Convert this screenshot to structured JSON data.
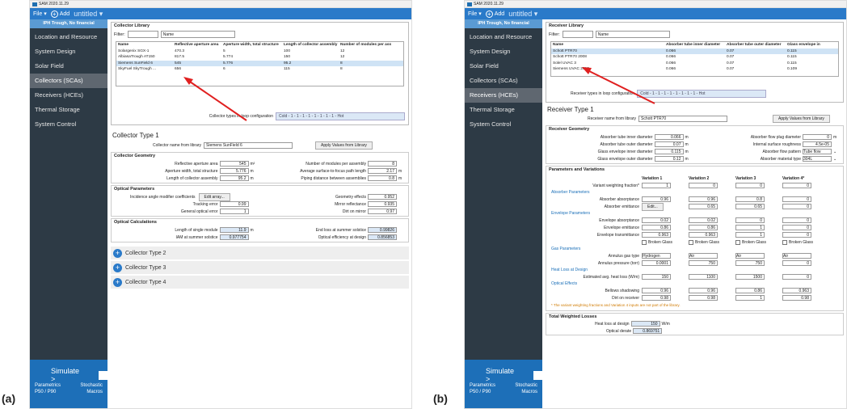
{
  "labels": {
    "a": "(a)",
    "b": "(b)"
  },
  "app": {
    "title": "SAM 2020.11.29",
    "file": "File ▾",
    "add": "Add",
    "filename": "untitled ▾"
  },
  "sidebar": {
    "caption": "IPH Trough, No financial",
    "items": [
      "Location and Resource",
      "System Design",
      "Solar Field",
      "Collectors (SCAs)",
      "Receivers (HCEs)",
      "Thermal Storage",
      "System Control"
    ],
    "simulate": "Simulate >",
    "bottom": [
      "Parametrics",
      "Stochastic",
      "P50 / P90",
      "Macros"
    ]
  },
  "pa": {
    "lib_title": "Collector Library",
    "filter": "Filter:",
    "filter_sel": "Name",
    "headers": [
      "Name",
      "Reflective aperture area",
      "Aperture width, total structure",
      "Length of collector assembly",
      "Number of modules per ass"
    ],
    "rows": [
      [
        "Solargenix SGX-1",
        "470.3",
        "5",
        "100",
        "12"
      ],
      [
        "AlbiasaTrough AT150",
        "817.5",
        "5.774",
        "150",
        "12"
      ],
      [
        "Siemens SunField 6",
        "545",
        "5.776",
        "95.2",
        "8"
      ],
      [
        "SkyFuel SkyTrough ...",
        "656",
        "6",
        "115",
        "8"
      ]
    ],
    "cfg_label": "Collector types in loop configuration",
    "cfg_value": "Cold - 1 - 1 - 1 - 1 - 1 - 1 - 1 - 1 - Hot",
    "type_title": "Collector Type 1",
    "name_label": "Collector name from library",
    "name_value": "Siemens SunField 6",
    "apply": "Apply Values from Library",
    "geom_title": "Collector Geometry",
    "geom_left": [
      {
        "l": "Reflective aperture area",
        "v": "545",
        "u": "m²"
      },
      {
        "l": "Aperture width, total structure",
        "v": "5.776",
        "u": "m"
      },
      {
        "l": "Length of collector assembly",
        "v": "95.2",
        "u": "m"
      }
    ],
    "geom_right": [
      {
        "l": "Number of modules per assembly",
        "v": "8",
        "u": ""
      },
      {
        "l": "Average surface-to-focus path length",
        "v": "2.17",
        "u": "m"
      },
      {
        "l": "Piping distance between assemblies",
        "v": "0.8",
        "u": "m"
      }
    ],
    "opt_title": "Optical Parameters",
    "iam_label": "Incidence angle modifier coefficients",
    "edit": "Edit array...",
    "opt_left": [
      {
        "l": "Tracking error",
        "v": "0.99"
      },
      {
        "l": "General optical error",
        "v": "1"
      }
    ],
    "opt_right": [
      {
        "l": "Geometry effects",
        "v": "0.952"
      },
      {
        "l": "Mirror reflectance",
        "v": "0.935"
      },
      {
        "l": "Dirt on mirror",
        "v": "0.97"
      }
    ],
    "calc_title": "Optical Calculations",
    "calc_left": [
      {
        "l": "Length of single module",
        "v": "11.9",
        "u": "m"
      },
      {
        "l": "IAM at summer solstice",
        "v": "0.977754",
        "u": ""
      }
    ],
    "calc_right": [
      {
        "l": "End loss at summer solstice",
        "v": "0.99826"
      },
      {
        "l": "Optical efficiency at design",
        "v": "0.856853"
      }
    ],
    "collapsed": [
      "Collector Type 2",
      "Collector Type 3",
      "Collector Type 4"
    ]
  },
  "pb": {
    "lib_title": "Receiver Library",
    "filter": "Filter:",
    "filter_sel": "Name",
    "headers": [
      "Name",
      "Absorber tube inner diameter",
      "Absorber tube outer diameter",
      "Glass envelope in"
    ],
    "rows": [
      [
        "Schott PTR70",
        "0.066",
        "0.07",
        "0.115"
      ],
      [
        "Schott PTR70 2008",
        "0.066",
        "0.07",
        "0.115"
      ],
      [
        "Solel UVAC 3",
        "0.066",
        "0.07",
        "0.115"
      ],
      [
        "Siemens UVAC 2010",
        "0.066",
        "0.07",
        "0.109"
      ]
    ],
    "cfg_label": "Receiver types in loop configuration",
    "cfg_value": "Cold - 1 - 1 - 1 - 1 - 1 - 1 - 1 - 1 - Hot",
    "type_title": "Receiver Type 1",
    "name_label": "Receiver name from library",
    "name_value": "Schott PTR70",
    "apply": "Apply Values from Library",
    "geom_title": "Receiver Geometry",
    "geom_left": [
      {
        "l": "Absorber tube inner diameter",
        "v": "0.066",
        "u": "m"
      },
      {
        "l": "Absorber tube outer diameter",
        "v": "0.07",
        "u": "m"
      },
      {
        "l": "Glass envelope inner diameter",
        "v": "0.115",
        "u": "m"
      },
      {
        "l": "Glass envelope outer diameter",
        "v": "0.12",
        "u": "m"
      }
    ],
    "geom_right": [
      {
        "l": "Absorber flow plug diameter",
        "v": "0",
        "u": "m"
      },
      {
        "l": "Internal surface roughness",
        "v": "4.5e-05",
        "u": ""
      },
      {
        "l": "Absorber flow pattern",
        "v": "Tube flow",
        "u": ""
      },
      {
        "l": "Absorber material type",
        "v": "304L",
        "u": ""
      }
    ],
    "var_title": "Parameters and Variations",
    "var_headers": [
      "Variation 1",
      "Variation 2",
      "Variation 3",
      "Variation 4*"
    ],
    "weight_label": "Variant weighting fraction*",
    "weights": [
      "1",
      "0",
      "0",
      "0"
    ],
    "abs_title": "Absorber Parameters",
    "absorptance_label": "Absorber absorptance",
    "absorptance": [
      "0.96",
      "0.96",
      "0.8",
      "0"
    ],
    "emittance_label": "Absorber emittance",
    "emittance": [
      "Edit...",
      "0.65",
      "0.65",
      "0"
    ],
    "env_title": "Envelope Parameters",
    "env_rows": [
      {
        "l": "Envelope absorptance",
        "v": [
          "0.02",
          "0.02",
          "0",
          "0"
        ]
      },
      {
        "l": "Envelope emittance",
        "v": [
          "0.86",
          "0.86",
          "1",
          "0"
        ]
      },
      {
        "l": "Envelope transmittance",
        "v": [
          "0.963",
          "0.963",
          "1",
          "0"
        ]
      }
    ],
    "broken": "Broken Glass",
    "gas_title": "Gas Parameters",
    "gas_label": "Annulus gas type",
    "gas": [
      "Hydrogen",
      "Air",
      "Air",
      "Air"
    ],
    "press_label": "Annulus pressure (torr)",
    "press": [
      "0.0001",
      "750",
      "750",
      "0"
    ],
    "heat_title": "Heat Loss at Design",
    "heat_label": "Estimated avg. heat loss (W/m)",
    "heat": [
      "150",
      "1100",
      "1500",
      "0"
    ],
    "opt_title": "Optical Effects",
    "bellows_label": "Bellows shadowing",
    "bellows": [
      "0.96",
      "0.96",
      "0.86",
      "0.963"
    ],
    "dirt_label": "Dirt on receiver",
    "dirt": [
      "0.98",
      "0.98",
      "1",
      "0.98"
    ],
    "note": "* The variant weighting fractions and Variation 4 inputs are not part of the library.",
    "total_title": "Total Weighted Losses",
    "total_rows": [
      {
        "l": "Heat loss at design",
        "v": "150",
        "u": "W/m"
      },
      {
        "l": "Optical derate",
        "v": "0.869751",
        "u": ""
      }
    ]
  }
}
